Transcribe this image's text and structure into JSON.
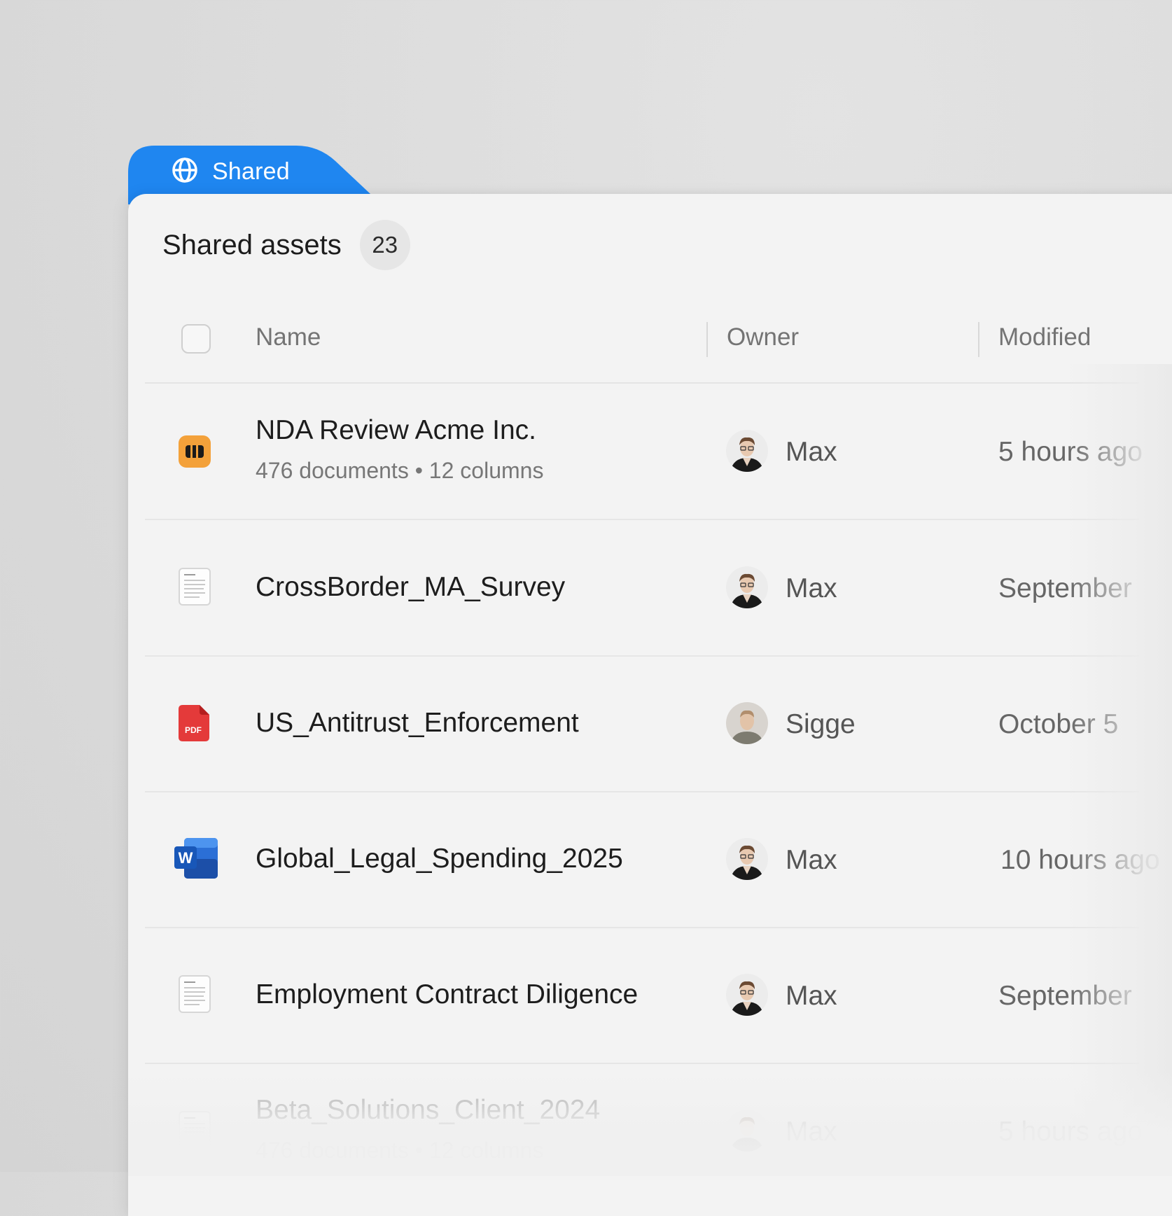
{
  "tab": {
    "label": "Shared",
    "icon": "globe-icon",
    "color": "#1f86f0"
  },
  "section": {
    "title": "Shared assets",
    "count": "23"
  },
  "columns": {
    "name": "Name",
    "owner": "Owner",
    "modified": "Modified"
  },
  "rows": [
    {
      "name": "NDA Review Acme Inc.",
      "subtitle": "476 documents • 12 columns",
      "icon": "review-table-icon",
      "owner": "Max",
      "modified": "5 hours ago"
    },
    {
      "name": "CrossBorder_MA_Survey",
      "icon": "document-icon",
      "owner": "Max",
      "modified": "September"
    },
    {
      "name": "US_Antitrust_Enforcement",
      "icon": "pdf-icon",
      "owner": "Sigge",
      "modified": "October 5"
    },
    {
      "name": "Global_Legal_Spending_2025",
      "icon": "word-icon",
      "owner": "Max",
      "modified": "10 hours ago"
    },
    {
      "name": "Employment Contract Diligence",
      "icon": "document-icon",
      "owner": "Max",
      "modified": "September"
    },
    {
      "name": "Beta_Solutions_Client_2024",
      "subtitle": "476 documents • 12 columns",
      "icon": "document-icon",
      "owner": "Max",
      "modified": "5 hours ago"
    }
  ]
}
